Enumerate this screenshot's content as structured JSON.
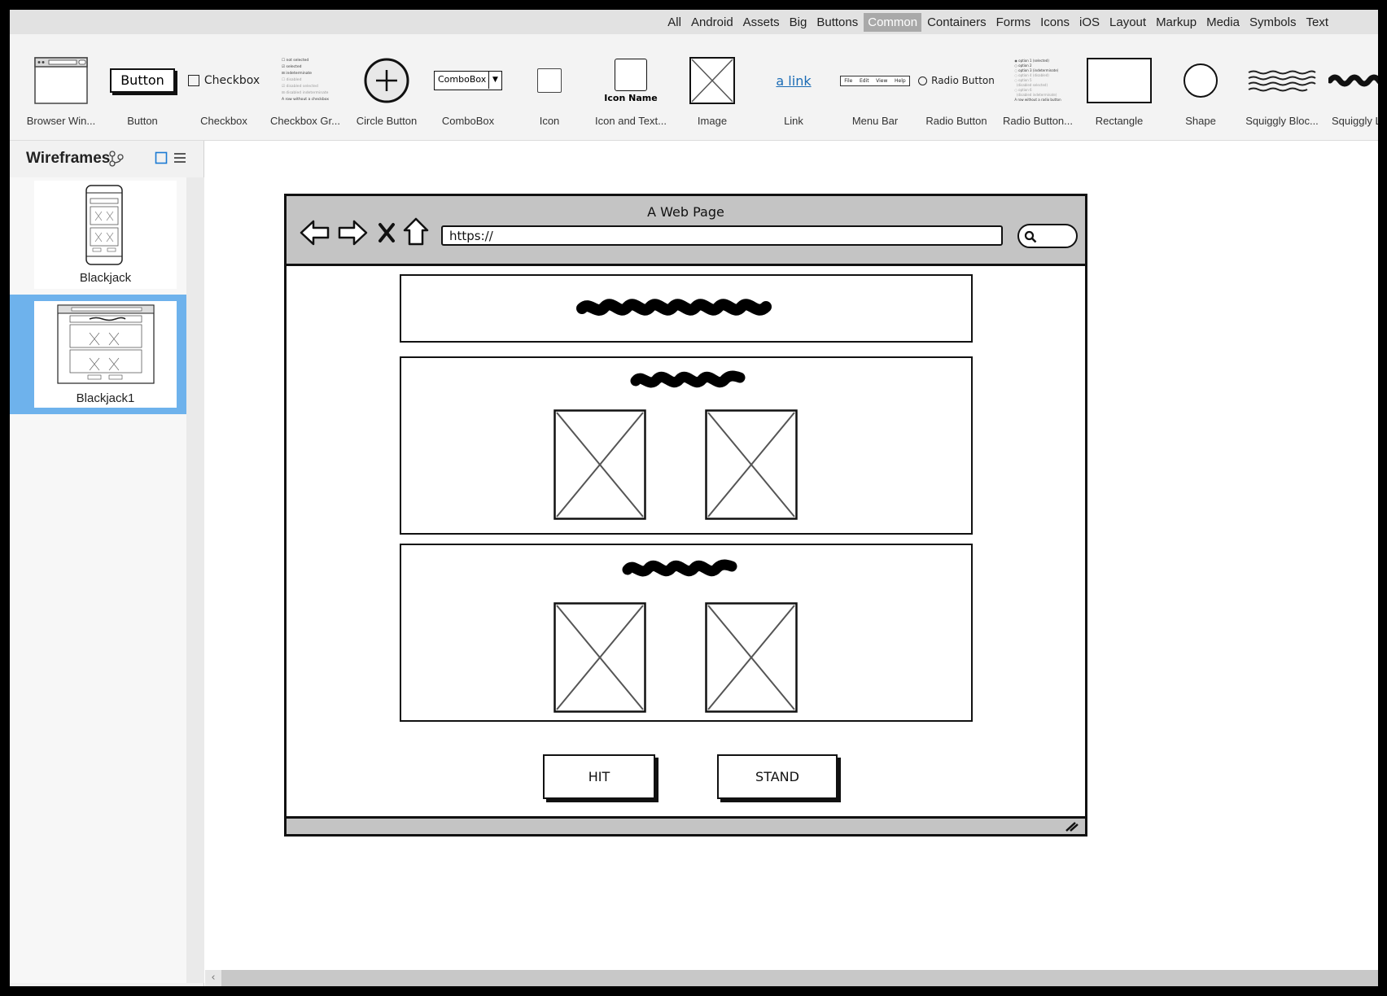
{
  "category_tabs": [
    {
      "label": "All",
      "active": false
    },
    {
      "label": "Android",
      "active": false
    },
    {
      "label": "Assets",
      "active": false
    },
    {
      "label": "Big",
      "active": false
    },
    {
      "label": "Buttons",
      "active": false
    },
    {
      "label": "Common",
      "active": true
    },
    {
      "label": "Containers",
      "active": false
    },
    {
      "label": "Forms",
      "active": false
    },
    {
      "label": "Icons",
      "active": false
    },
    {
      "label": "iOS",
      "active": false
    },
    {
      "label": "Layout",
      "active": false
    },
    {
      "label": "Markup",
      "active": false
    },
    {
      "label": "Media",
      "active": false
    },
    {
      "label": "Symbols",
      "active": false
    },
    {
      "label": "Text",
      "active": false
    }
  ],
  "library": {
    "items": [
      {
        "label": "Browser Win...",
        "icon": "browser-window"
      },
      {
        "label": "Button",
        "icon": "button",
        "preview_text": "Button"
      },
      {
        "label": "Checkbox",
        "icon": "checkbox",
        "preview_text": "Checkbox"
      },
      {
        "label": "Checkbox Gr...",
        "icon": "checkbox-group",
        "preview_lines": [
          "not selected",
          "selected",
          "indeterminate",
          "disabled",
          "disabled selected",
          "disabled indeterminate",
          "A row without a checkbox"
        ]
      },
      {
        "label": "Circle Button",
        "icon": "circle-button"
      },
      {
        "label": "ComboBox",
        "icon": "combobox",
        "preview_text": "ComboBox"
      },
      {
        "label": "Icon",
        "icon": "icon"
      },
      {
        "label": "Icon and Text...",
        "icon": "icon-and-text",
        "preview_text": "Icon Name"
      },
      {
        "label": "Image",
        "icon": "image"
      },
      {
        "label": "Link",
        "icon": "link",
        "preview_text": "a link"
      },
      {
        "label": "Menu Bar",
        "icon": "menu-bar",
        "preview_items": [
          "File",
          "Edit",
          "View",
          "Help"
        ]
      },
      {
        "label": "Radio Button",
        "icon": "radio-button",
        "preview_text": "Radio Button"
      },
      {
        "label": "Radio Button...",
        "icon": "radio-button-group",
        "preview_lines": [
          "option 1 (selected)",
          "option 2",
          "option 3 (indeterminate)",
          "option 4 (disabled)",
          "option 5",
          "(disabled selected)",
          "option 6",
          "(disabled indeterminate)",
          "A row without a radio button"
        ]
      },
      {
        "label": "Rectangle",
        "icon": "rectangle"
      },
      {
        "label": "Shape",
        "icon": "shape"
      },
      {
        "label": "Squiggly Bloc...",
        "icon": "squiggly-block"
      },
      {
        "label": "Squiggly Line",
        "icon": "squiggly-line"
      }
    ]
  },
  "panel": {
    "title": "Wireframes",
    "pages": [
      {
        "name": "Blackjack",
        "selected": false
      },
      {
        "name": "Blackjack1",
        "selected": true
      }
    ]
  },
  "wireframe": {
    "browser_title": "A Web Page",
    "url": "https://",
    "buttons": {
      "hit": "HIT",
      "stand": "STAND"
    }
  },
  "colors": {
    "selection": "#6eb2ec",
    "active_tab": "#a9a9a9",
    "browser_chrome": "#c4c4c4",
    "link": "#1a6bb5"
  }
}
